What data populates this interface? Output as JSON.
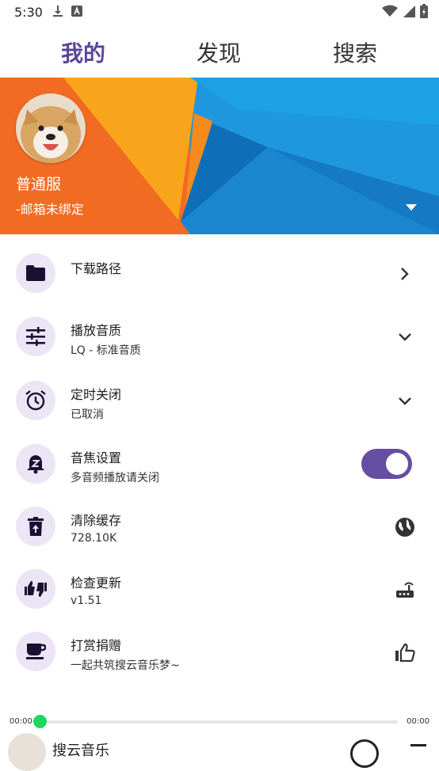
{
  "status_bar": {
    "time": "5:30"
  },
  "tabs": [
    {
      "label": "我的",
      "active": true
    },
    {
      "label": "发现",
      "active": false
    },
    {
      "label": "搜索",
      "active": false
    }
  ],
  "profile": {
    "name": "普通服",
    "email_status": "-邮箱未绑定"
  },
  "settings": {
    "download_path": {
      "title": "下载路径"
    },
    "play_quality": {
      "title": "播放音质",
      "subtitle": "LQ - 标准音质"
    },
    "timer_close": {
      "title": "定时关闭",
      "subtitle": "已取消"
    },
    "audio_focus": {
      "title": "音焦设置",
      "subtitle": "多音频播放请关闭",
      "enabled": true
    },
    "clear_cache": {
      "title": "清除缓存",
      "subtitle": "728.10K"
    },
    "check_update": {
      "title": "检查更新",
      "subtitle": "v1.51"
    },
    "donate": {
      "title": "打赏捐赠",
      "subtitle": "一起共筑搜云音乐梦~"
    }
  },
  "player": {
    "current_time": "00:00",
    "total_time": "00:00",
    "progress": 0,
    "now_playing_title": "搜云音乐"
  },
  "colors": {
    "accent": "#654ea3",
    "tab_active": "#5a4697",
    "icon_bg": "#ece5f6",
    "progress_thumb": "#1ed760"
  }
}
